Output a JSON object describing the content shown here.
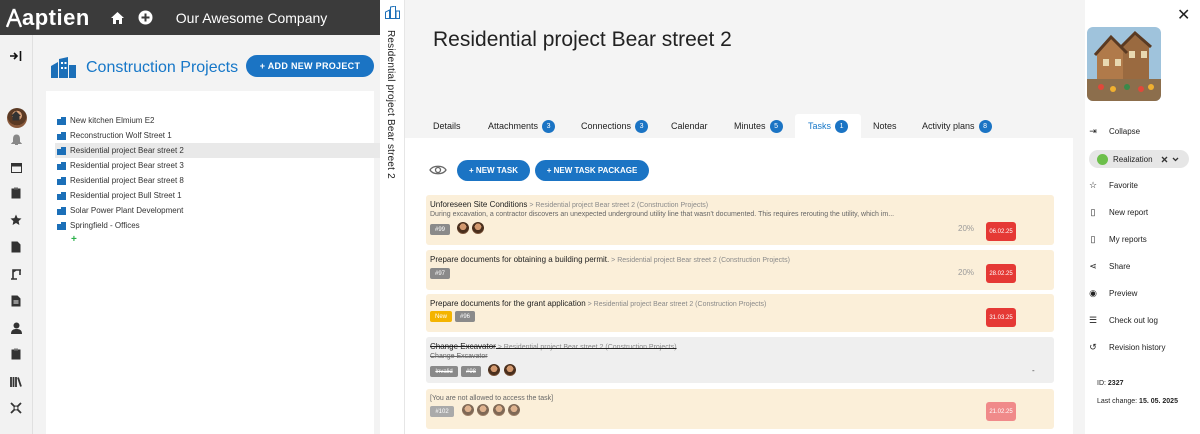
{
  "topbar": {
    "logo_text": "aptien",
    "company": "Our Awesome Company"
  },
  "list": {
    "title": "Construction Projects",
    "add_button": "+ ADD NEW PROJECT",
    "items": [
      {
        "label": "New kitchen Elmium E2"
      },
      {
        "label": "Reconstruction Wolf Street 1"
      },
      {
        "label": "Residential project Bear street 2"
      },
      {
        "label": "Residential project Bear street 3"
      },
      {
        "label": "Residential project Bear street 8"
      },
      {
        "label": "Residential project Bull Street 1"
      },
      {
        "label": "Solar Power Plant Development"
      },
      {
        "label": "Springfield - Offices"
      }
    ],
    "add_symbol": "+"
  },
  "detail": {
    "vertical_title": "Residential project Bear street 2",
    "title": "Residential project Bear street 2",
    "tabs": [
      {
        "label": "Details"
      },
      {
        "label": "Attachments",
        "count": "3"
      },
      {
        "label": "Connections",
        "count": "3"
      },
      {
        "label": "Calendar"
      },
      {
        "label": "Minutes",
        "count": "5"
      },
      {
        "label": "Tasks",
        "count": "1"
      },
      {
        "label": "Notes"
      },
      {
        "label": "Activity plans",
        "count": "8"
      }
    ],
    "new_task": "+ NEW TASK",
    "new_task_package": "+ NEW TASK PACKAGE",
    "tasks": [
      {
        "title": "Unforeseen Site Conditions",
        "path": " > Residential project Bear street 2 (Construction Projects)",
        "desc": "During excavation, a contractor discovers an unexpected underground utility line that wasn't documented. This requires rerouting the utility, which im...",
        "id": "#99",
        "percent": "20%",
        "date": "06.02.25"
      },
      {
        "title": "Prepare documents for obtaining a building permit.",
        "path": " > Residential project Bear street 2 (Construction Projects)",
        "id": "#97",
        "percent": "20%",
        "date": "28.02.25"
      },
      {
        "title": "Prepare documents for the grant application",
        "path": " > Residential project Bear street 2 (Construction Projects)",
        "status": "New",
        "id": "#96",
        "date": "31.03.25"
      },
      {
        "title": "Change Excavator",
        "path": " > Residential project Bear street 2 (Construction Projects)",
        "desc": "Change Excavator",
        "status": "Invalid",
        "id": "#98",
        "dash": "-"
      },
      {
        "desc": "[You are not allowed to access the task]",
        "id": "#102",
        "date": "21.02.25"
      }
    ]
  },
  "sidebar": {
    "collapse": "Collapse",
    "status": "Realization",
    "favorite": "Favorite",
    "new_report": "New report",
    "my_reports": "My reports",
    "share": "Share",
    "preview": "Preview",
    "checkout": "Check out log",
    "revision": "Revision history",
    "id_label": "ID:",
    "id_value": "2327",
    "last_change_label": "Last change:",
    "last_change_value": "15. 05. 2025"
  }
}
